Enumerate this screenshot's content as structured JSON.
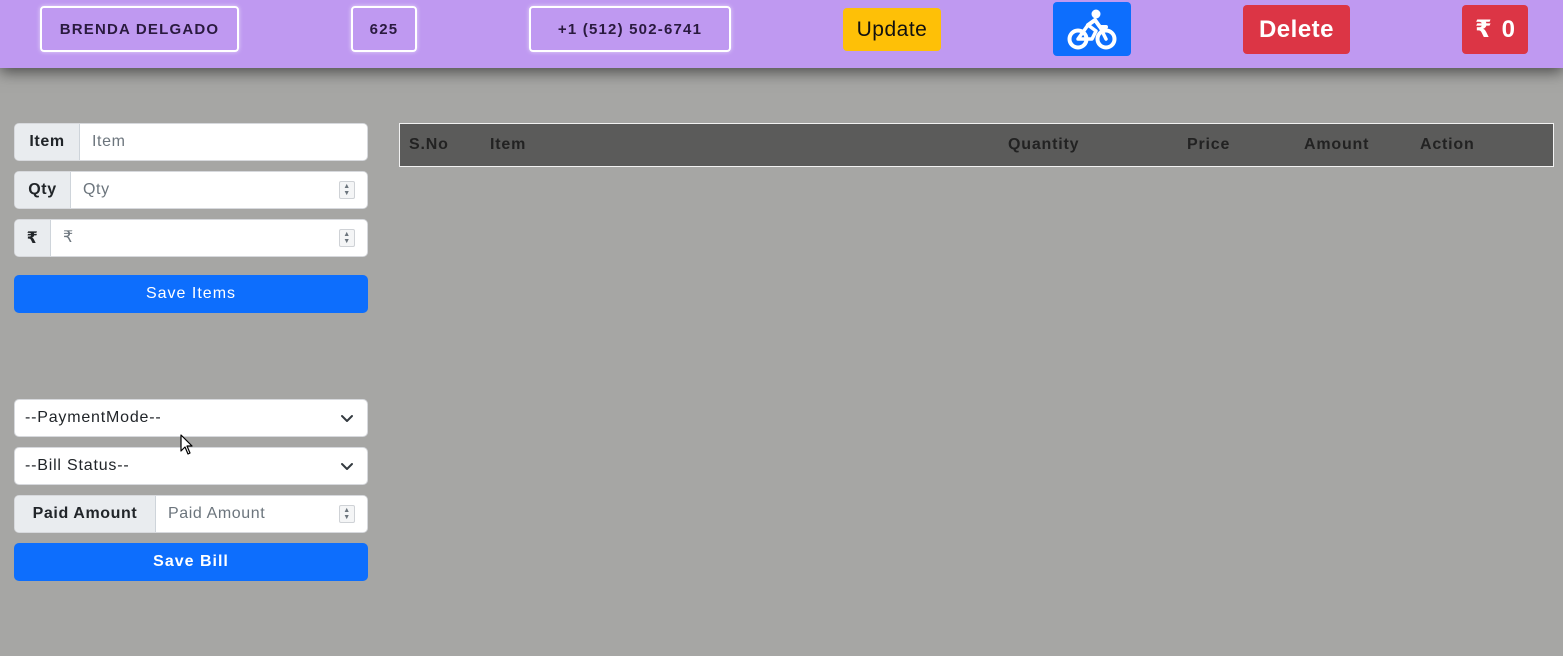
{
  "header": {
    "customer_name": "BRENDA DELGADO",
    "customer_number": "625",
    "phone": "+1 (512) 502-6741",
    "update_label": "Update",
    "bike_icon": "bicycle-icon",
    "delete_label": "Delete",
    "total_currency": "₹",
    "total_value": "0",
    "colors": {
      "bar": "#bf99f1",
      "update": "#fec007",
      "bike": "#0d6efd",
      "delete": "#dc3545"
    }
  },
  "item_form": {
    "item_label": "Item",
    "item_placeholder": "Item",
    "qty_label": "Qty",
    "qty_placeholder": "Qty",
    "price_label": "₹",
    "price_placeholder": "₹",
    "save_items_label": "Save Items"
  },
  "bill_form": {
    "payment_mode_selected": "--PaymentMode--",
    "bill_status_selected": "--Bill Status--",
    "paid_amount_label": "Paid Amount",
    "paid_amount_placeholder": "Paid Amount",
    "save_bill_label": "Save Bill"
  },
  "table": {
    "columns": [
      "S.No",
      "Item",
      "Quantity",
      "Price",
      "Amount",
      "Action"
    ],
    "rows": []
  }
}
